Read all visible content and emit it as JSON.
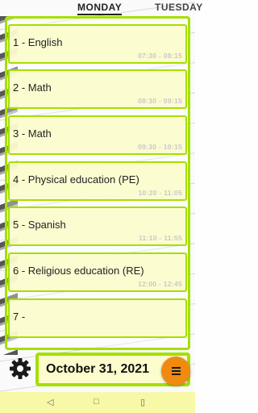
{
  "tabs": [
    {
      "label": "MONDAY"
    },
    {
      "label": "TUESDAY"
    }
  ],
  "lessons": [
    {
      "label": "1 - English",
      "time": "07:30 - 08:15"
    },
    {
      "label": "2 - Math",
      "time": "08:30 - 09:15"
    },
    {
      "label": "3 - Math",
      "time": "09:30 - 10:15"
    },
    {
      "label": "4 - Physical education (PE)",
      "time": "10:20 - 11:05"
    },
    {
      "label": "5 - Spanish",
      "time": "11:10 - 11:55"
    },
    {
      "label": "6 - Religious education (RE)",
      "time": "12:00 - 12:45"
    },
    {
      "label": "7 -",
      "time": ""
    }
  ],
  "footer": {
    "date": "October 31, 2021",
    "settings_icon": "gear-icon",
    "menu_icon": "menu-icon"
  },
  "navbar": {
    "back": "◁",
    "home": "□",
    "recents": "▯"
  },
  "colors": {
    "accent": "#a4e000",
    "row_bg": "#fcfccd",
    "fab": "#f08a10",
    "navbar": "#f7f9a7"
  }
}
